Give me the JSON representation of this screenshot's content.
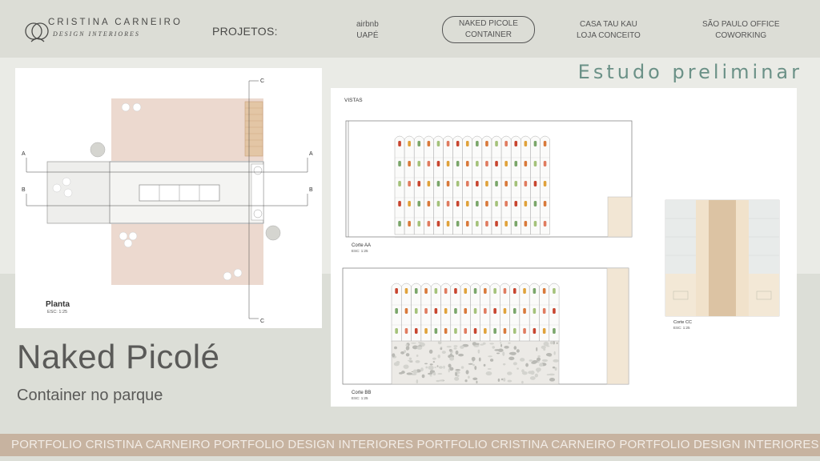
{
  "brand": {
    "name": "CRISTINA CARNEIRO",
    "subtitle": "DESIGN INTERIORES"
  },
  "nav": {
    "label": "PROJETOS:",
    "items": [
      {
        "line1": "airbnb",
        "line2": "UAPÉ",
        "active": false
      },
      {
        "line1": "NAKED PICOLE",
        "line2": "CONTAINER",
        "active": true
      },
      {
        "line1": "CASA TAU KAU",
        "line2": "LOJA CONCEITO",
        "active": false
      },
      {
        "line1": "SÃO PAULO OFFICE",
        "line2": "COWORKING",
        "active": false
      }
    ]
  },
  "section_heading": "Estudo preliminar",
  "planta": {
    "title": "Planta",
    "scale": "ESC: 1:25",
    "section_marks": [
      "A",
      "B",
      "C"
    ]
  },
  "vistas": {
    "heading": "VISTAS",
    "corte_aa": {
      "title": "Corte AA",
      "scale": "ESC: 1:25"
    },
    "corte_bb": {
      "title": "Corte BB",
      "scale": "ESC: 1:25"
    },
    "corte_cc": {
      "title": "Corte CC",
      "scale": "ESC: 1:25"
    }
  },
  "project": {
    "title": "Naked Picolé",
    "subtitle": "Container no parque"
  },
  "footer": {
    "marquee": "PORTFOLIO CRISTINA CARNEIRO PORTFOLIO DESIGN INTERIORES PORTFOLIO CRISTINA CARNEIRO PORTFOLIO DESIGN INTERIORES"
  },
  "colors": {
    "accent": "#6b9187",
    "footer_band": "#c7b3a0",
    "wood": "#ecd9cf",
    "header": "#dcddd6"
  }
}
